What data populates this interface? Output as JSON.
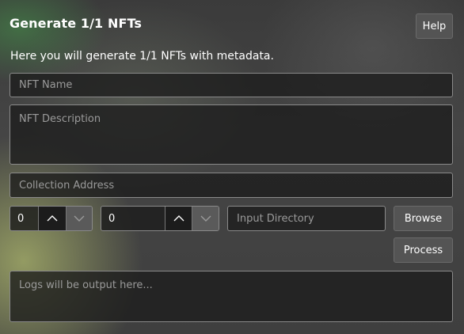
{
  "header": {
    "title": "Generate 1/1 NFTs",
    "help_label": "Help"
  },
  "subtitle": "Here you will generate 1/1 NFTs with metadata.",
  "form": {
    "nft_name_placeholder": "NFT Name",
    "nft_description_placeholder": "NFT Description",
    "collection_address_placeholder": "Collection Address",
    "stepper1_value": "0",
    "stepper2_value": "0",
    "input_directory_placeholder": "Input Directory",
    "browse_label": "Browse",
    "process_label": "Process",
    "logs_placeholder": "Logs will be output here..."
  },
  "icons": {
    "increment": "chevron-up-icon",
    "decrement": "chevron-down-icon"
  }
}
